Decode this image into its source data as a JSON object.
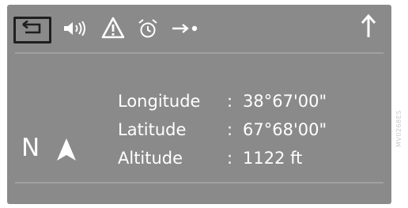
{
  "toolbar": {
    "icons": [
      "back-arrow-icon",
      "speaker-volume-icon",
      "warning-triangle-icon",
      "alarm-clock-icon",
      "arrow-dot-icon",
      "up-arrow-icon"
    ]
  },
  "compass": {
    "direction": "N",
    "icon": "north-arrow-icon"
  },
  "position": {
    "rows": [
      {
        "label": "Longitude",
        "sep": ":",
        "value": "38°67'00\""
      },
      {
        "label": "Latitude",
        "sep": ":",
        "value": "67°68'00\""
      },
      {
        "label": "Altitude",
        "sep": ":",
        "value": "1122 ft"
      }
    ]
  },
  "watermark": {
    "text": "MV0268ES"
  },
  "colors": {
    "screen_bg": "#8a8a8a",
    "text": "#ffffff",
    "icon": "#ffffff",
    "frame": "#1f1f1f"
  }
}
